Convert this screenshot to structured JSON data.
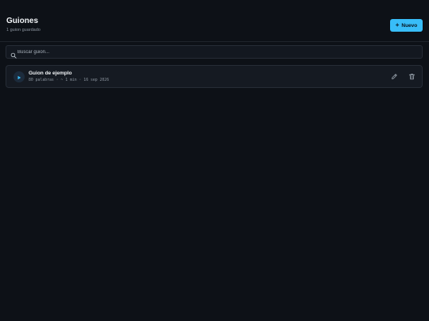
{
  "header": {
    "title": "Guiones",
    "subtitle": "1 guion guardado",
    "new_button_label": "Nuevo",
    "new_button_icon": "plus-icon"
  },
  "search": {
    "placeholder": "Buscar guion...",
    "value": "",
    "icon": "search-icon"
  },
  "scripts": [
    {
      "title": "Guion de ejemplo",
      "meta": "80 palabras · ~ 1 min · 16 sep 2026",
      "play_icon": "play-icon",
      "edit_icon": "pencil-icon",
      "delete_icon": "trash-icon"
    }
  ],
  "colors": {
    "background": "#0d1117",
    "accent": "#38bdf8",
    "card": "#151a22"
  }
}
